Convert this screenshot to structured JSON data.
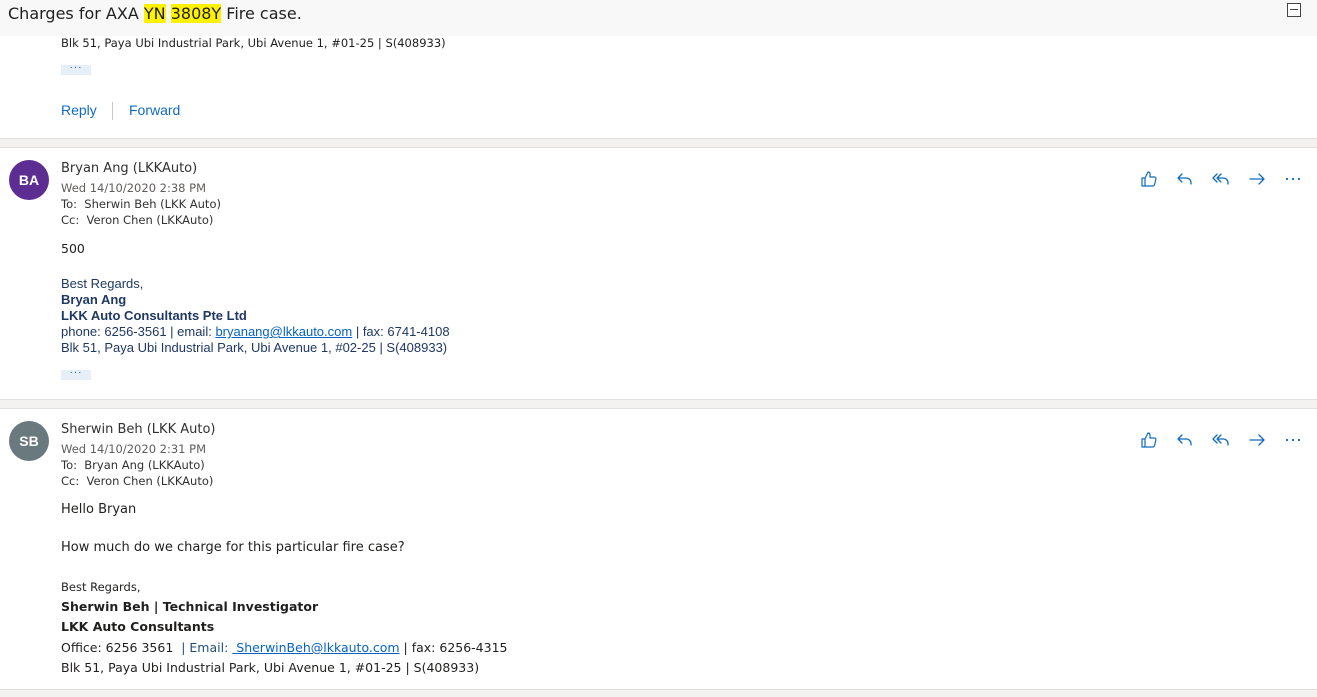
{
  "subject": {
    "prefix": "Charges for AXA ",
    "hl1": "YN",
    "space": " ",
    "hl2": "3808Y",
    "suffix": " Fire case."
  },
  "top_fragment": {
    "address": "Blk 51, Paya Ubi Industrial Park, Ubi Avenue 1, #01-25 | S(408933)",
    "more": "···",
    "reply": "Reply",
    "forward": "Forward"
  },
  "messages": [
    {
      "initials": "BA",
      "avatar_color": "#5c2e91",
      "sender": "Bryan Ang (LKKAuto)",
      "date": "Wed 14/10/2020 2:38 PM",
      "to_label": "To:",
      "to": "Sherwin Beh (LKK Auto)",
      "cc_label": "Cc:",
      "cc": "Veron Chen (LKKAuto)",
      "body": [
        "500"
      ],
      "signature": {
        "greeting": "Best Regards,",
        "name": "Bryan Ang",
        "company": "LKK Auto Consultants Pte Ltd",
        "contact_pre": "phone: 6256-3561 | email: ",
        "email": "bryanang@lkkauto.com",
        "contact_post": " | fax: 6741-4108",
        "address": "Blk 51, Paya Ubi Industrial Park, Ubi Avenue 1, #02-25 | S(408933)"
      },
      "more": "···"
    },
    {
      "initials": "SB",
      "avatar_color": "#69797e",
      "sender": "Sherwin Beh (LKK Auto)",
      "date": "Wed 14/10/2020 2:31 PM",
      "to_label": "To:",
      "to": "Bryan Ang (LKKAuto)",
      "cc_label": "Cc:",
      "cc": "Veron Chen (LKKAuto)",
      "body": [
        "Hello Bryan",
        "How much do we charge for this particular fire case?"
      ],
      "signature": {
        "greeting": "Best Regards,",
        "name": "Sherwin Beh | Technical Investigator",
        "company": "LKK Auto Consultants",
        "office": "Office: 6256 3561",
        "email_label": "  | Email: ",
        "email": " SherwinBeh@lkkauto.com",
        "fax": " | fax: 6256-4315",
        "address": "Blk 51, Paya Ubi Industrial Park, Ubi Avenue 1, #01-25 | S(408933)"
      }
    }
  ],
  "icons": [
    "like-icon",
    "reply-icon",
    "reply-all-icon",
    "forward-icon",
    "more-icon",
    "collapse-icon"
  ],
  "colors": {
    "link": "#0f6cbd",
    "highlight": "#fff100",
    "signature_blue": "#1f3864"
  }
}
